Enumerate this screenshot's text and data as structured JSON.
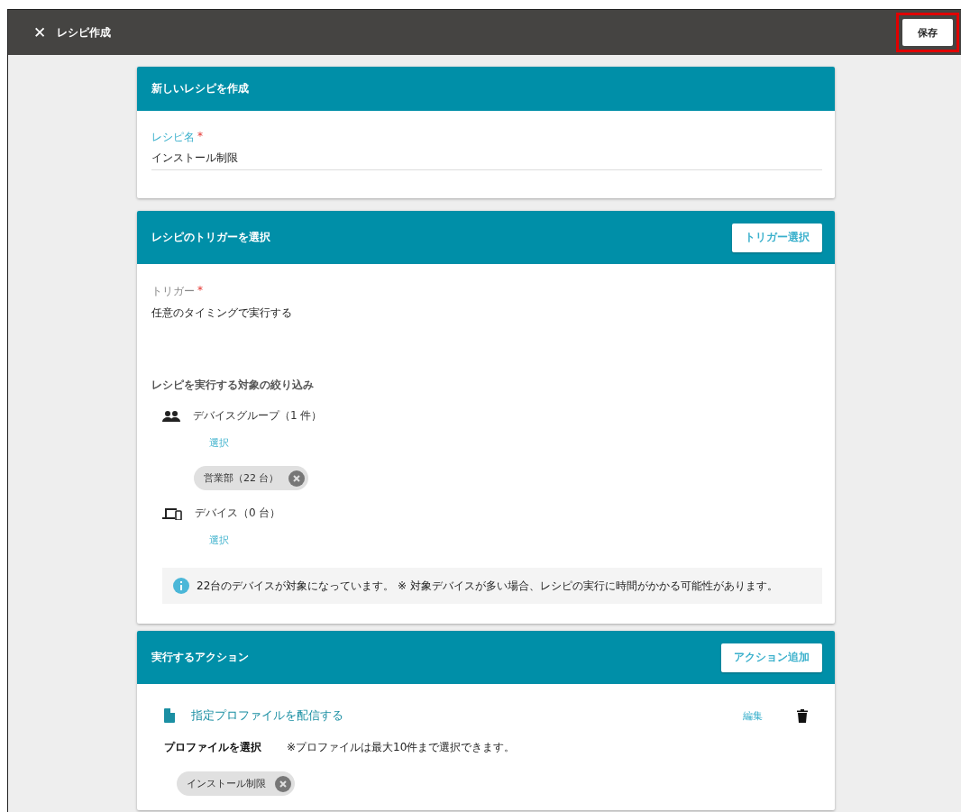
{
  "app_bar": {
    "close": "✕",
    "title": "レシピ作成",
    "save_button": {
      "label": "保存",
      "highlighted": true
    }
  },
  "name_card": {
    "title": "新しいレシピを作成",
    "field": {
      "label": "レシピ名",
      "required": "*",
      "value": "インストール制限"
    }
  },
  "trigger_card": {
    "title": "レシピのトリガーを選択",
    "button": "トリガー選択",
    "trigger": {
      "label": "トリガー",
      "required": "*",
      "value": "任意のタイミングで実行する"
    },
    "filter_title": "レシピを実行する対象の絞り込み",
    "targets": [
      {
        "kind": "group",
        "label": "デバイスグループ（1 件）",
        "select": "選択",
        "chips": [
          "営業部（22 台）"
        ]
      },
      {
        "kind": "device",
        "label": "デバイス（0 台）",
        "select": "選択"
      }
    ],
    "notice": "22台のデバイスが対象になっています。 ※ 対象デバイスが多い場合、レシピの実行に時間がかかる可能性があります。"
  },
  "action_card": {
    "title": "実行するアクション",
    "button": "アクション追加",
    "actions": [
      {
        "title": "指定プロファイルを配信する",
        "edit": "編集",
        "field_label": "プロファイルを選択",
        "hint": "※プロファイルは最大10件まで選択できます。",
        "chips": [
          "インストール制限"
        ]
      }
    ]
  }
}
